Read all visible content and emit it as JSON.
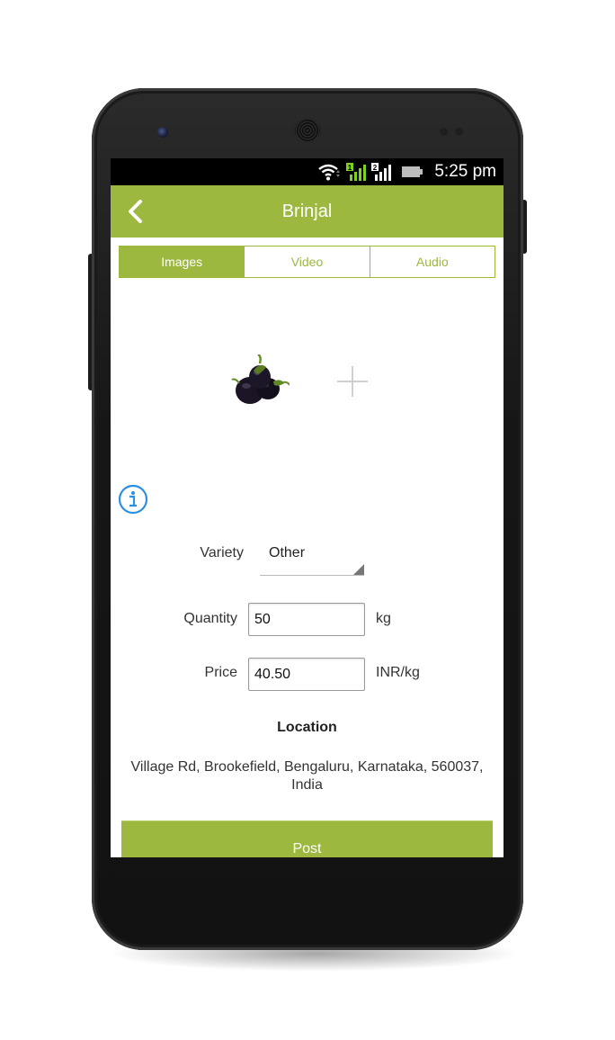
{
  "status_bar": {
    "time": "5:25 pm",
    "sim1_label": "1",
    "sim2_label": "2",
    "icons": [
      "wifi-icon",
      "sim1-signal-icon",
      "sim2-signal-icon",
      "battery-icon"
    ]
  },
  "app_bar": {
    "title": "Brinjal",
    "back_icon": "chevron-left-icon"
  },
  "tabs": [
    {
      "label": "Images",
      "active": true
    },
    {
      "label": "Video",
      "active": false
    },
    {
      "label": "Audio",
      "active": false
    }
  ],
  "media": {
    "items": [
      "eggplant-image"
    ],
    "add_icon": "plus-icon"
  },
  "info_icon": "info-icon",
  "form": {
    "variety": {
      "label": "Variety",
      "value": "Other"
    },
    "quantity": {
      "label": "Quantity",
      "value": "50",
      "unit": "kg"
    },
    "price": {
      "label": "Price",
      "value": "40.50",
      "unit": "INR/kg"
    }
  },
  "location": {
    "title": "Location",
    "address": "Village Rd, Brookefield, Bengaluru, Karnataka, 560037, India"
  },
  "post_button": {
    "label": "Post"
  },
  "colors": {
    "accent": "#9cb83f",
    "status_bar": "#000000",
    "info_blue": "#2d8fe0"
  }
}
